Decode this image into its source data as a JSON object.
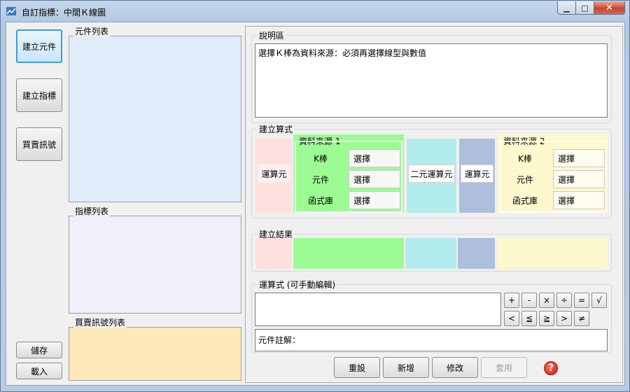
{
  "window": {
    "title": "自訂指標：中間Ｋ線圖"
  },
  "colors": {
    "component_list": "#e1ecfb",
    "indicator_list": "#f0effa",
    "signal_list": "#fde8b8",
    "pink": "#fde0de",
    "green": "#9dfb93",
    "cyan": "#b3ecec",
    "blue": "#adbfdc",
    "yellow": "#fdf8cd"
  },
  "sidebar": {
    "build_component": "建立元件",
    "build_indicator": "建立指標",
    "trade_signal": "買賣訊號",
    "save": "儲存",
    "load": "載入"
  },
  "lists": {
    "component_list": "元件列表",
    "indicator_list": "指標列表",
    "signal_list": "買賣訊號列表"
  },
  "description": {
    "label": "說明區",
    "text": "選擇Ｋ棒為資料來源：必須再選擇線型與數值"
  },
  "formula_builder": {
    "label": "建立算式",
    "operator1": "運算元",
    "source1": {
      "title": "資料來源 1",
      "rows": [
        {
          "label": "K棒",
          "button": "選擇"
        },
        {
          "label": "元件",
          "button": "選擇"
        },
        {
          "label": "函式庫",
          "button": "選擇"
        }
      ]
    },
    "binary_op": "二元運算元",
    "operator2": "運算元",
    "source2": {
      "title": "資料來源 2",
      "rows": [
        {
          "label": "K棒",
          "button": "選擇"
        },
        {
          "label": "元件",
          "button": "選擇"
        },
        {
          "label": "函式庫",
          "button": "選擇"
        }
      ]
    }
  },
  "result": {
    "label": "建立結果"
  },
  "expression": {
    "label": "運算式 (可手動編輯)",
    "value": "",
    "ops_row1": [
      "+",
      "-",
      "×",
      "÷",
      "=",
      "√"
    ],
    "ops_row2": [
      "<",
      "≦",
      "≧",
      ">",
      "≠"
    ]
  },
  "annotation": {
    "text": "元件註解："
  },
  "actions": {
    "reset": "重設",
    "add": "新增",
    "modify": "修改",
    "apply": "套用"
  }
}
